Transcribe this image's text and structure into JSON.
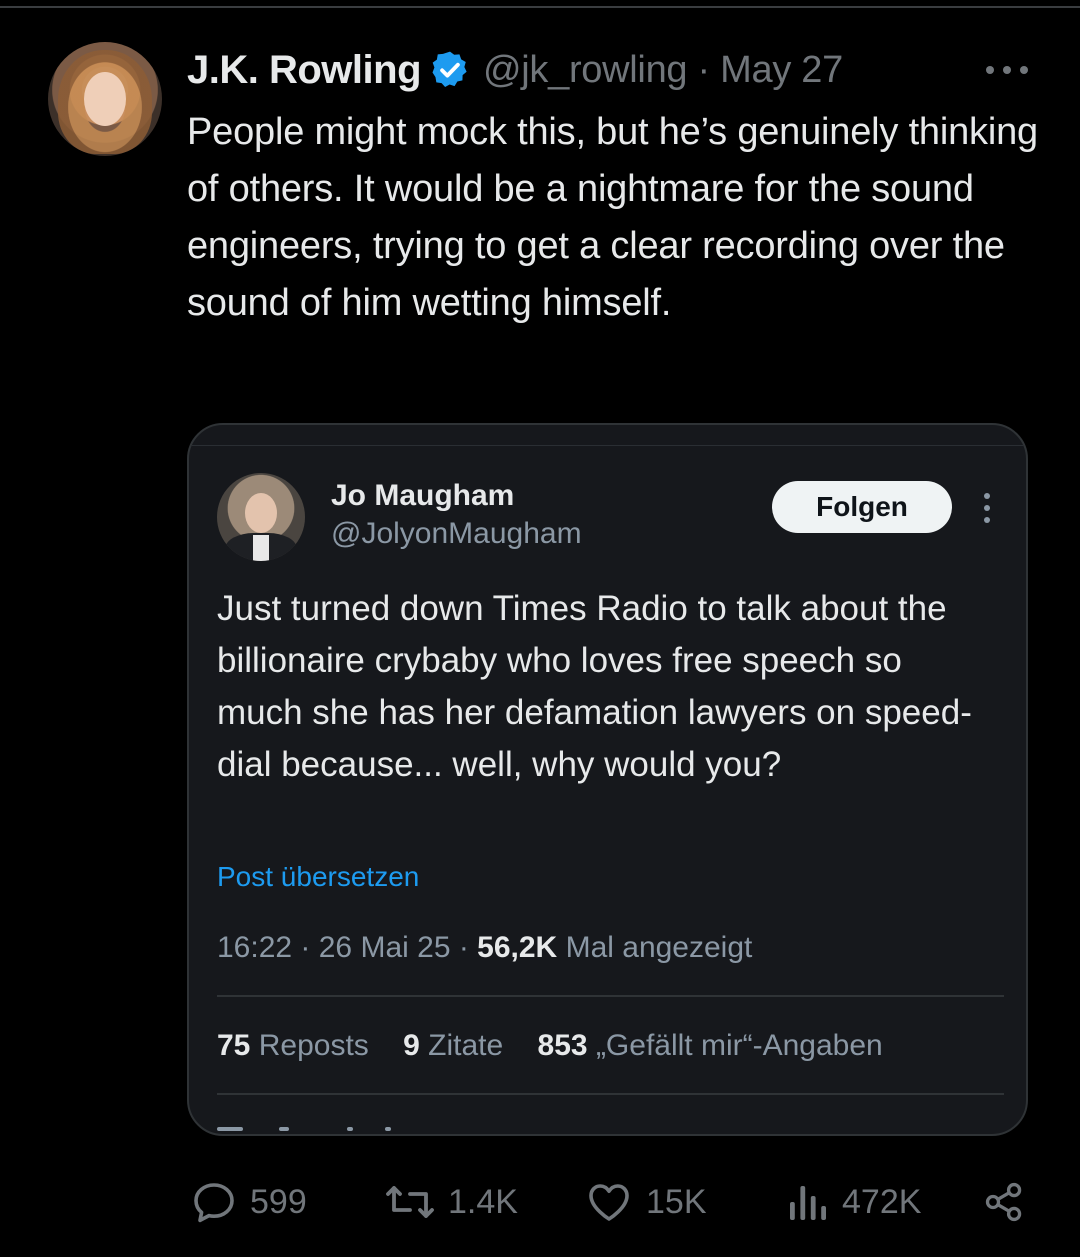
{
  "tweet": {
    "author_name": "J.K. Rowling",
    "handle": "@jk_rowling",
    "separator": "·",
    "date": "May 27",
    "text": "People might mock this, but he’s genuinely thinking of others. It would be a nightmare for the sound engineers, trying to get a clear recording over the sound of him wetting himself.",
    "verified_color": "#1d9bf0"
  },
  "quoted": {
    "author_name": "Jo Maugham",
    "handle": "@JolyonMaugham",
    "follow_label": "Folgen",
    "text": "Just turned down Times Radio to talk about the billionaire crybaby who loves free speech so much she has her defamation lawyers on speed-dial because... well, why would you?",
    "translate_label": "Post übersetzen",
    "time": "16:22",
    "date": "26 Mai 25",
    "views_count": "56,2K",
    "views_label": "Mal angezeigt",
    "reposts_count": "75",
    "reposts_label": "Reposts",
    "quotes_count": "9",
    "quotes_label": "Zitate",
    "likes_count": "853",
    "likes_label": "„Gefällt mir“-Angaben"
  },
  "actions": {
    "replies": "599",
    "reposts": "1.4K",
    "likes": "15K",
    "views": "472K"
  },
  "icons": {
    "more": "more-horizontal-icon",
    "verified": "verified-badge-icon",
    "reply": "reply-icon",
    "repost": "repost-icon",
    "like": "heart-icon",
    "views": "views-bar-chart-icon",
    "share": "share-icon"
  },
  "colors": {
    "background": "#000000",
    "card_background": "#16181c",
    "muted_text": "#71767b",
    "link": "#1d9bf0"
  }
}
